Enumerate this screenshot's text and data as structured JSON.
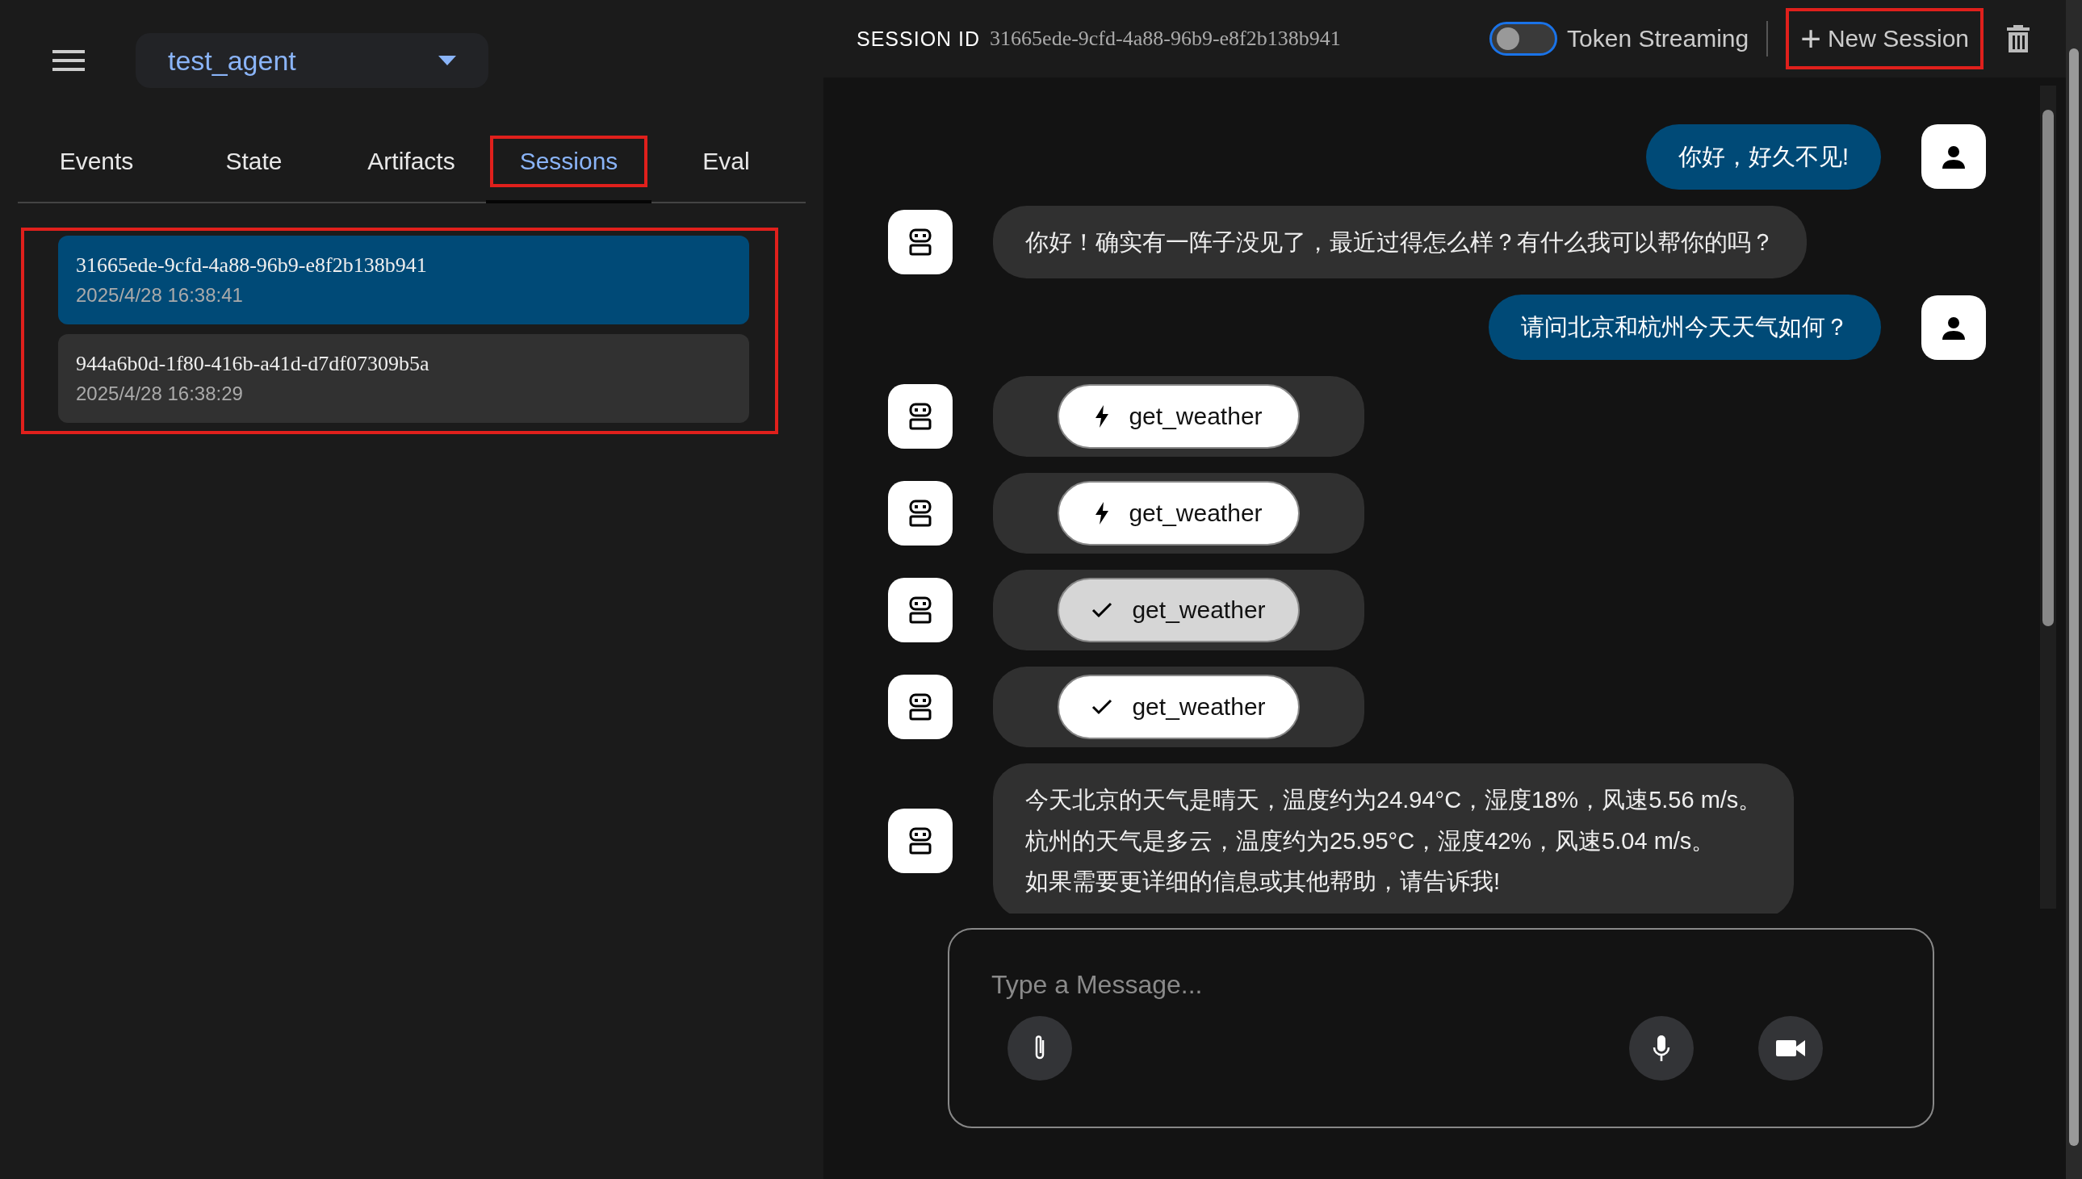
{
  "sidebar": {
    "agent": "test_agent",
    "tabs": [
      {
        "label": "Events",
        "selected": false,
        "highlighted": false
      },
      {
        "label": "State",
        "selected": false,
        "highlighted": false
      },
      {
        "label": "Artifacts",
        "selected": false,
        "highlighted": false
      },
      {
        "label": "Sessions",
        "selected": true,
        "highlighted": true
      },
      {
        "label": "Eval",
        "selected": false,
        "highlighted": false
      }
    ],
    "sessions": {
      "highlighted": true,
      "items": [
        {
          "id": "31665ede-9cfd-4a88-96b9-e8f2b138b941",
          "time": "2025/4/28 16:38:41",
          "selected": true
        },
        {
          "id": "944a6b0d-1f80-416b-a41d-d7df07309b5a",
          "time": "2025/4/28 16:38:29",
          "selected": false
        }
      ]
    }
  },
  "header": {
    "session_label": "SESSION ID",
    "session_id": "31665ede-9cfd-4a88-96b9-e8f2b138b941",
    "token_streaming": {
      "label": "Token Streaming",
      "on": false
    },
    "new_session": {
      "icon": "+",
      "label": "New Session",
      "highlighted": true
    }
  },
  "messages": [
    {
      "kind": "user",
      "text": "你好，好久不见!"
    },
    {
      "kind": "agent",
      "text": "你好！确实有一阵子没见了，最近过得怎么样？有什么我可以帮你的吗？"
    },
    {
      "kind": "user",
      "text": "请问北京和杭州今天天气如何？"
    },
    {
      "kind": "function_call",
      "name": "get_weather",
      "selected": false
    },
    {
      "kind": "function_call",
      "name": "get_weather",
      "selected": false
    },
    {
      "kind": "function_response",
      "name": "get_weather",
      "selected": true
    },
    {
      "kind": "function_response",
      "name": "get_weather",
      "selected": false
    },
    {
      "kind": "agent_lines",
      "lines": [
        "今天北京的天气是晴天，温度约为24.94°C，湿度18%，风速5.56 m/s。",
        "杭州的天气是多云，温度约为25.95°C，湿度42%，风速5.04 m/s。",
        "如果需要更详细的信息或其他帮助，请告诉我!"
      ]
    }
  ],
  "input": {
    "placeholder": "Type a Message..."
  }
}
